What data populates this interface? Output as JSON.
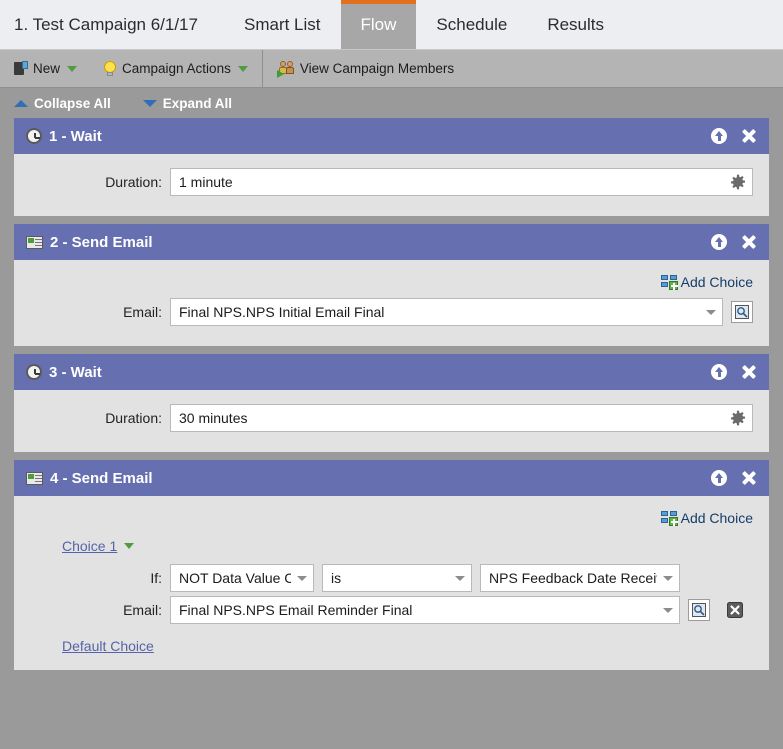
{
  "tabs": [
    {
      "label": "1. Test Campaign 6/1/17",
      "active": false
    },
    {
      "label": "Smart List",
      "active": false
    },
    {
      "label": "Flow",
      "active": true
    },
    {
      "label": "Schedule",
      "active": false
    },
    {
      "label": "Results",
      "active": false
    }
  ],
  "toolbar": {
    "new_label": "New",
    "new_icon": "new-document-icon",
    "campaign_actions_label": "Campaign Actions",
    "campaign_actions_icon": "lightbulb-icon",
    "view_members_label": "View Campaign Members",
    "view_members_icon": "people-icon"
  },
  "collapse_bar": {
    "collapse_all": "Collapse All",
    "expand_all": "Expand All"
  },
  "colors": {
    "step_header": "#6670b0",
    "step_body": "#e2e2e2",
    "page_background": "#9a9a9a",
    "toolbar": "#b4b4b4",
    "tab_active_accent": "#e2711d",
    "tab_active_background": "#a7a7a7",
    "link": "#5663a8",
    "add_choice_text": "#153d6b"
  },
  "steps": [
    {
      "title": "1 - Wait",
      "icon": "clock-icon",
      "fields": [
        {
          "label": "Duration:",
          "value": "1 minute",
          "trailing_icon": "gear-icon"
        }
      ]
    },
    {
      "title": "2 - Send Email",
      "icon": "envelope-icon",
      "add_choice": "Add Choice",
      "fields": [
        {
          "label": "Email:",
          "value": "Final NPS.NPS Initial Email Final",
          "trailing_icon": "preview-icon"
        }
      ]
    },
    {
      "title": "3 - Wait",
      "icon": "clock-icon",
      "fields": [
        {
          "label": "Duration:",
          "value": "30 minutes",
          "trailing_icon": "gear-icon"
        }
      ]
    },
    {
      "title": "4 - Send Email",
      "icon": "envelope-icon",
      "add_choice": "Add Choice",
      "choice_label": "Choice 1",
      "if_row": {
        "label": "If:",
        "condition_type": "NOT Data Value Cl",
        "operator": "is",
        "attribute": "NPS Feedback Date Receive"
      },
      "email_row": {
        "label": "Email:",
        "value": "Final NPS.NPS Email Reminder Final"
      },
      "default_choice": "Default Choice"
    }
  ]
}
